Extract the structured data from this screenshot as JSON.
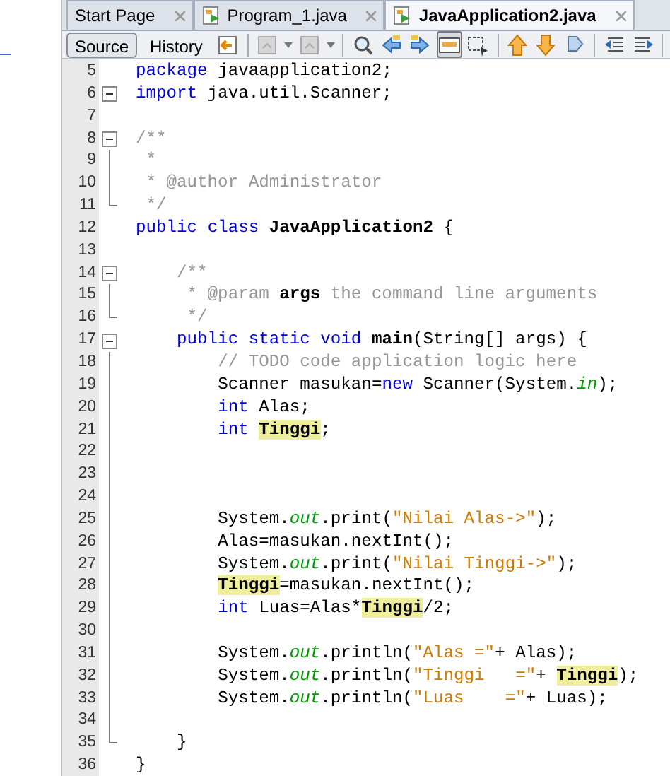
{
  "tabs": [
    {
      "label": "Start Page",
      "selected": false,
      "file": false
    },
    {
      "label": "Program_1.java",
      "selected": false,
      "file": true
    },
    {
      "label": "JavaApplication2.java",
      "selected": true,
      "file": true
    }
  ],
  "view_buttons": [
    {
      "label": "Source",
      "selected": true
    },
    {
      "label": "History",
      "selected": false
    }
  ],
  "toolbar": [
    {
      "kind": "back",
      "pressed": false
    },
    {
      "kind": "sep"
    },
    {
      "kind": "prev-edit",
      "pressed": false
    },
    {
      "kind": "dropdown"
    },
    {
      "kind": "next-edit",
      "pressed": false
    },
    {
      "kind": "dropdown"
    },
    {
      "kind": "sep"
    },
    {
      "kind": "find",
      "pressed": false
    },
    {
      "kind": "find-prev",
      "pressed": false
    },
    {
      "kind": "find-next",
      "pressed": false
    },
    {
      "kind": "highlight",
      "pressed": true
    },
    {
      "kind": "select",
      "pressed": false
    },
    {
      "kind": "sep"
    },
    {
      "kind": "bookmark-prev",
      "pressed": false
    },
    {
      "kind": "bookmark-next",
      "pressed": false
    },
    {
      "kind": "bookmark-toggle",
      "pressed": false
    },
    {
      "kind": "sep"
    },
    {
      "kind": "shift-left",
      "pressed": false
    },
    {
      "kind": "shift-right",
      "pressed": false
    },
    {
      "kind": "sep"
    }
  ],
  "lines": [
    {
      "number": "5",
      "fold_start": false,
      "fold_line": false,
      "fold_end": false,
      "tokens": [
        {
          "kind": "kw",
          "text": "package"
        },
        {
          "kind": "plain",
          "text": " javaapplication2;"
        }
      ]
    },
    {
      "number": "6",
      "fold_start": true,
      "fold_line": false,
      "fold_end": false,
      "tokens": [
        {
          "kind": "kw",
          "text": "import"
        },
        {
          "kind": "plain",
          "text": " java.util.Scanner;"
        }
      ]
    },
    {
      "number": "7",
      "fold_start": false,
      "fold_line": false,
      "fold_end": false
    },
    {
      "number": "8",
      "fold_start": true,
      "fold_line": false,
      "fold_end": false,
      "tokens": [
        {
          "kind": "comment",
          "text": "/**"
        }
      ]
    },
    {
      "number": "9",
      "fold_start": false,
      "fold_line": true,
      "fold_end": false,
      "tokens": [
        {
          "kind": "comment",
          "text": " *"
        }
      ]
    },
    {
      "number": "10",
      "fold_start": false,
      "fold_line": true,
      "fold_end": false,
      "tokens": [
        {
          "kind": "comment",
          "text": " * @author Administrator"
        }
      ]
    },
    {
      "number": "11",
      "fold_start": false,
      "fold_line": false,
      "fold_end": true,
      "tokens": [
        {
          "kind": "comment",
          "text": " */"
        }
      ]
    },
    {
      "number": "12",
      "fold_start": false,
      "fold_line": false,
      "fold_end": false,
      "tokens": [
        {
          "kind": "kw",
          "text": "public "
        },
        {
          "kind": "kw",
          "text": "class "
        },
        {
          "kind": "bold",
          "text": "JavaApplication2"
        },
        {
          "kind": "plain",
          "text": " {"
        }
      ]
    },
    {
      "number": "13",
      "fold_start": false,
      "fold_line": false,
      "fold_end": false
    },
    {
      "number": "14",
      "fold_start": true,
      "fold_line": false,
      "fold_end": false,
      "tokens": [
        {
          "kind": "comment",
          "text": "/**"
        }
      ]
    },
    {
      "number": "15",
      "fold_start": false,
      "fold_line": true,
      "fold_end": false,
      "tokens": [
        {
          "kind": "comment",
          "text": " * @param "
        },
        {
          "kind": "bold",
          "text": "args"
        },
        {
          "kind": "comment",
          "text": " the command line arguments"
        }
      ]
    },
    {
      "number": "16",
      "fold_start": false,
      "fold_line": false,
      "fold_end": true,
      "tokens": [
        {
          "kind": "comment",
          "text": " */"
        }
      ]
    },
    {
      "number": "17",
      "fold_start": true,
      "fold_line": false,
      "fold_end": false,
      "tokens": [
        {
          "kind": "kw",
          "text": "public "
        },
        {
          "kind": "kw",
          "text": "static "
        },
        {
          "kind": "kw",
          "text": "void "
        },
        {
          "kind": "bold",
          "text": "main"
        },
        {
          "kind": "plain",
          "text": "(String[] args) {"
        }
      ]
    },
    {
      "number": "18",
      "fold_start": false,
      "fold_line": true,
      "fold_end": false,
      "tokens": [
        {
          "kind": "comment",
          "text": "// TODO code application logic here"
        }
      ]
    },
    {
      "number": "19",
      "fold_start": false,
      "fold_line": true,
      "fold_end": false,
      "tokens": [
        {
          "kind": "plain",
          "text": "Scanner masukan="
        },
        {
          "kind": "kw",
          "text": "new"
        },
        {
          "kind": "plain",
          "text": " Scanner(System."
        },
        {
          "kind": "field",
          "text": "in"
        },
        {
          "kind": "plain",
          "text": ");"
        }
      ]
    },
    {
      "number": "20",
      "fold_start": false,
      "fold_line": true,
      "fold_end": false,
      "tokens": [
        {
          "kind": "kw",
          "text": "int"
        },
        {
          "kind": "plain",
          "text": " Alas;"
        }
      ]
    },
    {
      "number": "21",
      "fold_start": false,
      "fold_line": true,
      "fold_end": false,
      "tokens": [
        {
          "kind": "kw",
          "text": "int "
        },
        {
          "kind": "mark",
          "text": "Tinggi"
        },
        {
          "kind": "plain",
          "text": ";"
        }
      ]
    },
    {
      "number": "22",
      "fold_start": false,
      "fold_line": true,
      "fold_end": false
    },
    {
      "number": "23",
      "fold_start": false,
      "fold_line": true,
      "fold_end": false
    },
    {
      "number": "24",
      "fold_start": false,
      "fold_line": true,
      "fold_end": false
    },
    {
      "number": "25",
      "fold_start": false,
      "fold_line": true,
      "fold_end": false,
      "tokens": [
        {
          "kind": "plain",
          "text": "System."
        },
        {
          "kind": "field",
          "text": "out"
        },
        {
          "kind": "plain",
          "text": ".print("
        },
        {
          "kind": "string",
          "text": "\"Nilai Alas->\""
        },
        {
          "kind": "plain",
          "text": ");"
        }
      ]
    },
    {
      "number": "26",
      "fold_start": false,
      "fold_line": true,
      "fold_end": false,
      "tokens": [
        {
          "kind": "plain",
          "text": "Alas=masukan.nextInt();"
        }
      ]
    },
    {
      "number": "27",
      "fold_start": false,
      "fold_line": true,
      "fold_end": false,
      "tokens": [
        {
          "kind": "plain",
          "text": "System."
        },
        {
          "kind": "field",
          "text": "out"
        },
        {
          "kind": "plain",
          "text": ".print("
        },
        {
          "kind": "string",
          "text": "\"Nilai Tinggi->\""
        },
        {
          "kind": "plain",
          "text": ");"
        }
      ]
    },
    {
      "number": "28",
      "fold_start": false,
      "fold_line": true,
      "fold_end": false,
      "tokens": [
        {
          "kind": "mark",
          "text": "Tinggi"
        },
        {
          "kind": "plain",
          "text": "=masukan.nextInt();"
        }
      ]
    },
    {
      "number": "29",
      "fold_start": false,
      "fold_line": true,
      "fold_end": false,
      "tokens": [
        {
          "kind": "kw",
          "text": "int"
        },
        {
          "kind": "plain",
          "text": " Luas=Alas*"
        },
        {
          "kind": "mark",
          "text": "Tinggi"
        },
        {
          "kind": "plain",
          "text": "/2;"
        }
      ]
    },
    {
      "number": "30",
      "fold_start": false,
      "fold_line": true,
      "fold_end": false
    },
    {
      "number": "31",
      "fold_start": false,
      "fold_line": true,
      "fold_end": false,
      "tokens": [
        {
          "kind": "plain",
          "text": "System."
        },
        {
          "kind": "field",
          "text": "out"
        },
        {
          "kind": "plain",
          "text": ".println("
        },
        {
          "kind": "string",
          "text": "\"Alas =\""
        },
        {
          "kind": "plain",
          "text": "+ Alas);"
        }
      ]
    },
    {
      "number": "32",
      "fold_start": false,
      "fold_line": true,
      "fold_end": false,
      "tokens": [
        {
          "kind": "plain",
          "text": "System."
        },
        {
          "kind": "field",
          "text": "out"
        },
        {
          "kind": "plain",
          "text": ".println("
        },
        {
          "kind": "string",
          "text": "\"Tinggi   =\""
        },
        {
          "kind": "plain",
          "text": "+ "
        },
        {
          "kind": "mark",
          "text": "Tinggi"
        },
        {
          "kind": "plain",
          "text": ");"
        }
      ]
    },
    {
      "number": "33",
      "fold_start": false,
      "fold_line": true,
      "fold_end": false,
      "tokens": [
        {
          "kind": "plain",
          "text": "System."
        },
        {
          "kind": "field",
          "text": "out"
        },
        {
          "kind": "plain",
          "text": ".println("
        },
        {
          "kind": "string",
          "text": "\"Luas    =\""
        },
        {
          "kind": "plain",
          "text": "+ Luas);"
        }
      ]
    },
    {
      "number": "34",
      "fold_start": false,
      "fold_line": true,
      "fold_end": false
    },
    {
      "number": "35",
      "fold_start": false,
      "fold_line": false,
      "fold_end": true,
      "tokens": [
        {
          "kind": "plain",
          "text": "}"
        }
      ]
    },
    {
      "number": "36",
      "fold_start": false,
      "fold_line": false,
      "fold_end": false,
      "tokens": [
        {
          "kind": "plain",
          "text": "}"
        }
      ]
    }
  ]
}
